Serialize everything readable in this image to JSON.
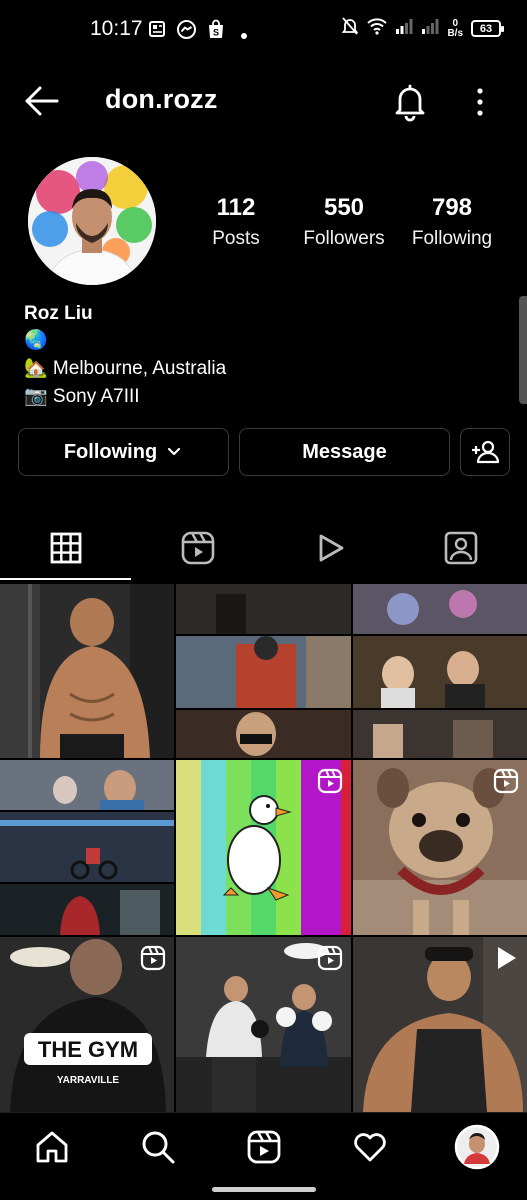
{
  "status_bar": {
    "time": "10:17",
    "net_speed_value": "0",
    "net_speed_unit": "B/s",
    "battery": "63"
  },
  "header": {
    "username": "don.rozz"
  },
  "profile": {
    "stats": [
      {
        "value": "112",
        "label": "Posts"
      },
      {
        "value": "550",
        "label": "Followers"
      },
      {
        "value": "798",
        "label": "Following"
      }
    ],
    "name": "Roz Liu",
    "bio_lines": [
      "🌏",
      "🏡 Melbourne, Australia",
      "📷 Sony A7III"
    ]
  },
  "actions": {
    "following_label": "Following",
    "message_label": "Message"
  },
  "tabs": [
    "grid-icon",
    "reels-icon",
    "video-icon",
    "tagged-icon"
  ],
  "posts": {
    "badges": [
      "",
      "",
      "",
      "",
      "reel",
      "reel",
      "reel",
      "reel",
      "video"
    ],
    "tile_text": {
      "gym_banner": "THE GYM",
      "gym_location": "YARRAVILLE"
    }
  },
  "colors": {
    "background": "#000000",
    "text": "#ffffff",
    "button_border": "#3a3a3a"
  }
}
